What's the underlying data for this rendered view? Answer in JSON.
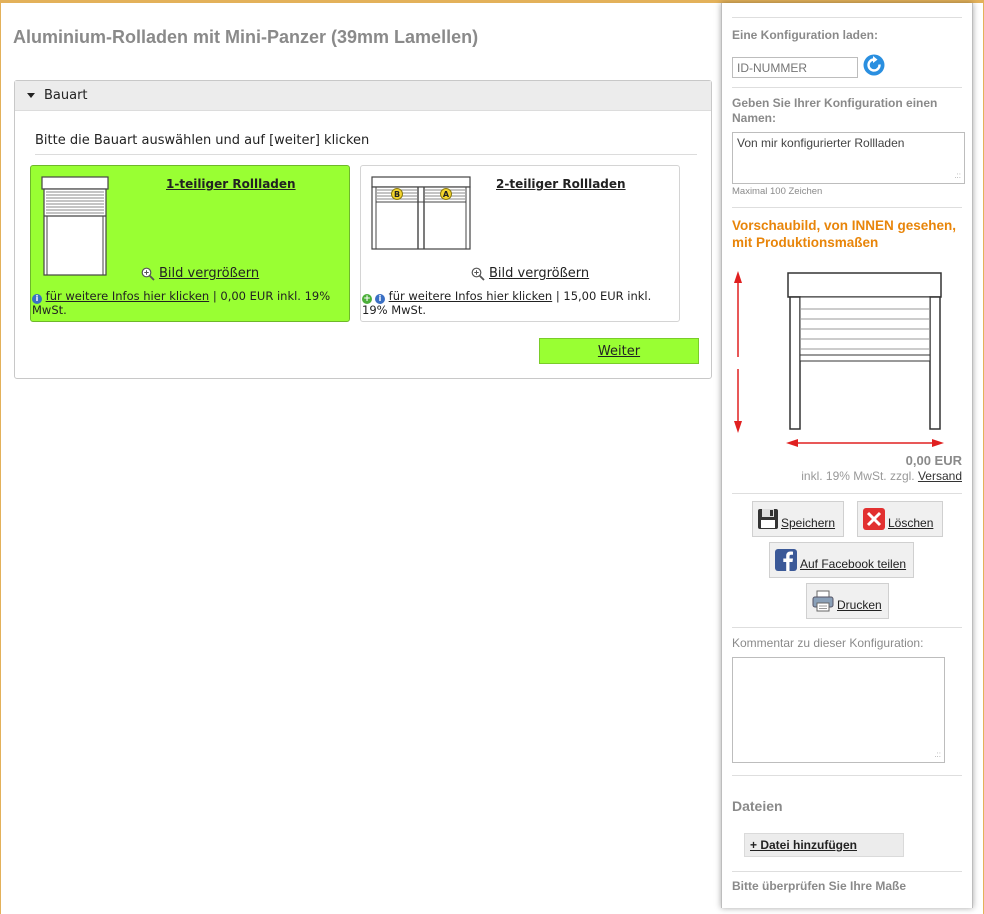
{
  "page": {
    "title": "Aluminium-Rolladen mit Mini-Panzer (39mm Lamellen)"
  },
  "section": {
    "header": "Bauart",
    "instruction": "Bitte die Bauart auswählen und auf [weiter] klicken",
    "options": [
      {
        "title": "1-teiliger Rollladen",
        "zoom": "Bild vergrößern",
        "info_link": "für weitere Infos hier klicken",
        "price_text": " | 0,00 EUR inkl. 19% MwSt.",
        "selected": true
      },
      {
        "title": "2-teiliger Rollladen",
        "zoom": "Bild vergrößern",
        "info_link": "für weitere Infos hier klicken",
        "price_text": " | 15,00 EUR inkl. 19% MwSt.",
        "selected": false,
        "badge_b": "B",
        "badge_a": "A"
      }
    ],
    "next_button": "Weiter"
  },
  "sidebar": {
    "load_label": "Eine Konfiguration laden:",
    "id_placeholder": "ID-NUMMER",
    "name_label": "Geben Sie Ihrer Konfiguration einen Namen:",
    "name_value": "Von mir konfigurierter Rollladen",
    "max_chars": "Maximal 100 Zeichen",
    "preview_title": "Vorschaubild, von INNEN gesehen, mit Produktionsmaßen",
    "price": "0,00 EUR",
    "price_note": "inkl. 19% MwSt. zzgl. ",
    "shipping_link": "Versand",
    "buttons": {
      "save": "Speichern",
      "delete": "Löschen",
      "facebook": "Auf Facebook teilen",
      "print": "Drucken"
    },
    "comment_label": "Kommentar zu dieser Konfiguration:",
    "files_title": "Dateien",
    "add_file": "+ Datei hinzufügen",
    "check_note": "Bitte überprüfen Sie Ihre Maße"
  },
  "colors": {
    "accent_green": "#99ff33",
    "preview_orange": "#e8850a",
    "arrow_red": "#e02020"
  }
}
